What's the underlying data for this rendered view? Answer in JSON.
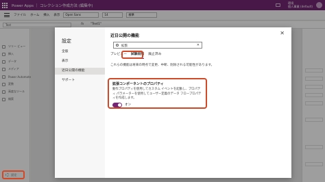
{
  "titlebar": {
    "app_title": "Power Apps ｜ コレクション作成方法 (編集中)",
    "env_line1": "環境",
    "env_line2": "個人事業 (default)"
  },
  "ribbon": {
    "items": [
      "ファイル",
      "ホーム",
      "挿入",
      "表示"
    ],
    "font": "Open Sans",
    "size": "14",
    "weight": "標準"
  },
  "formula": {
    "property": "Text",
    "fx": "fx",
    "value": "\"Text1\""
  },
  "sidebar": {
    "items": [
      "ツリー ビュー",
      "挿入",
      "データ",
      "メディア",
      "Power Automate",
      "変数",
      "高度なツール",
      "検索"
    ],
    "settings_label": "設定"
  },
  "dialog": {
    "title": "設定",
    "nav": [
      "全般",
      "表示",
      "近日公開の機能",
      "サポート"
    ],
    "main_title": "近日公開の機能",
    "search_value": "拡張",
    "tabs": [
      "プレビュー",
      "試験段階",
      "廃止済み"
    ],
    "description": "これらの機能は将来の時点で変更、中断、削除される可能性があります。",
    "feature_title": "拡張コンポーネントのプロパティ",
    "feature_description": "動作プロパティを使用してカスタム イベントを起動し、プロパティ パラメーターを使用してユーザー定義のデータ フロープロパティを作成します。",
    "toggle_label": "オン",
    "toggle_on": true
  },
  "colors": {
    "brand": "#742774",
    "highlight": "#d24726"
  }
}
